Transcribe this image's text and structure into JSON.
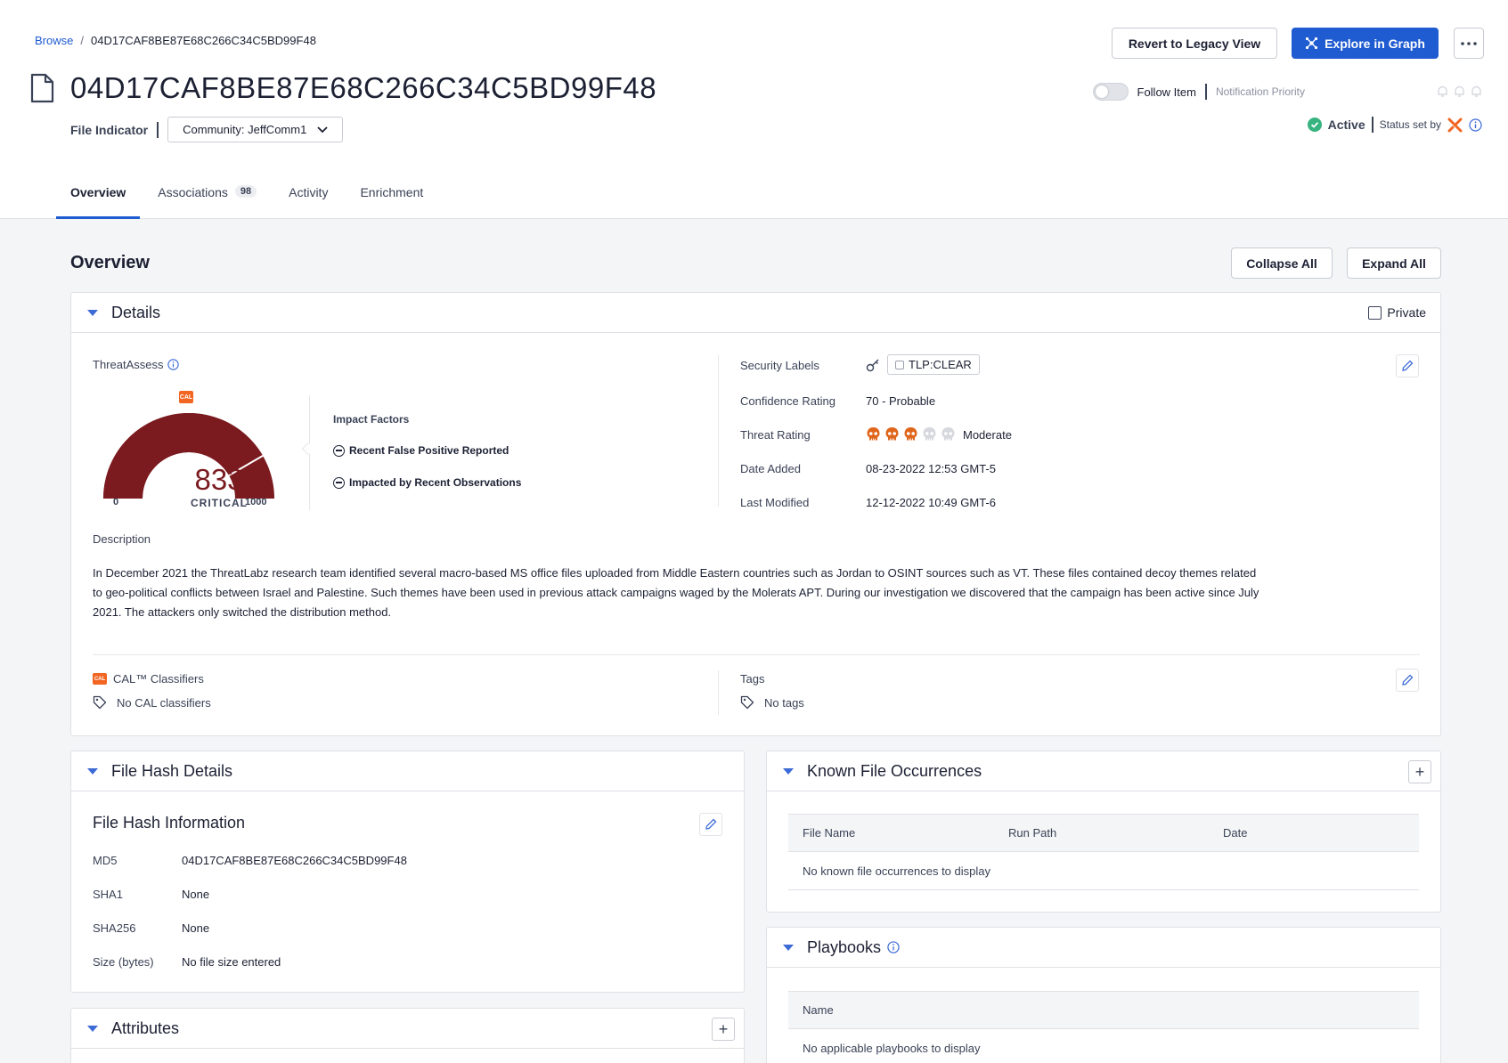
{
  "breadcrumb": {
    "root": "Browse",
    "current": "04D17CAF8BE87E68C266C34C5BD99F48"
  },
  "header": {
    "title": "04D17CAF8BE87E68C266C34C5BD99F48",
    "type": "File Indicator",
    "community": "Community: JeffComm1",
    "revert_label": "Revert to Legacy View",
    "explore_label": "Explore in Graph",
    "follow_label": "Follow Item",
    "notification_label": "Notification Priority",
    "status": "Active",
    "status_set_by": "Status set by"
  },
  "tabs": [
    {
      "label": "Overview"
    },
    {
      "label": "Associations",
      "count": "98"
    },
    {
      "label": "Activity"
    },
    {
      "label": "Enrichment"
    }
  ],
  "overview": {
    "title": "Overview",
    "collapse_label": "Collapse All",
    "expand_label": "Expand All"
  },
  "details": {
    "title": "Details",
    "private_label": "Private",
    "threat_assess_label": "ThreatAssess",
    "cal_badge": "CAL",
    "gauge": {
      "value": 833,
      "min": 0,
      "max": 1000,
      "label": "CRITICAL",
      "min_label": "0",
      "max_label": "1000",
      "value_label": "833"
    },
    "impact_title": "Impact Factors",
    "impact_items": [
      "Recent False Positive Reported",
      "Impacted by Recent Observations"
    ],
    "security_labels_label": "Security Labels",
    "tlp": "TLP:CLEAR",
    "confidence_label": "Confidence Rating",
    "confidence_value": "70 - Probable",
    "threat_rating_label": "Threat Rating",
    "threat_rating_value": "Moderate",
    "threat_rating_level": 3,
    "threat_rating_max": 5,
    "date_added_label": "Date Added",
    "date_added_value": "08-23-2022 12:53 GMT-5",
    "last_modified_label": "Last Modified",
    "last_modified_value": "12-12-2022 10:49 GMT-6",
    "description_label": "Description",
    "description_lines": [
      "In December 2021 the ThreatLabz research team identified several macro-based MS office files uploaded from Middle Eastern countries such as Jordan to OSINT sources such as VT. These files contained decoy themes related",
      "to geo-political conflicts between Israel and Palestine. Such themes have been used in previous attack campaigns waged by the Molerats APT. During our investigation we discovered that the campaign has been active since July",
      "2021. The attackers only switched the distribution method."
    ],
    "cal_classifiers_label": "CAL™ Classifiers",
    "cal_classifiers_value": "No CAL classifiers",
    "tags_label": "Tags",
    "tags_value": "No tags"
  },
  "file_hash": {
    "title": "File Hash Details",
    "subtitle": "File Hash Information",
    "rows": [
      {
        "label": "MD5",
        "value": "04D17CAF8BE87E68C266C34C5BD99F48"
      },
      {
        "label": "SHA1",
        "value": "None"
      },
      {
        "label": "SHA256",
        "value": "None"
      },
      {
        "label": "Size (bytes)",
        "value": "No file size entered"
      }
    ]
  },
  "attributes": {
    "title": "Attributes"
  },
  "known_occurrences": {
    "title": "Known File Occurrences",
    "columns": [
      "File Name",
      "Run Path",
      "Date"
    ],
    "empty": "No known file occurrences to display"
  },
  "playbooks": {
    "title": "Playbooks",
    "columns": [
      "Name"
    ],
    "empty": "No applicable playbooks to display"
  },
  "colors": {
    "primary": "#1f5bd1",
    "gauge": "#7b1a1f",
    "skull_active": "#e0661b",
    "skull_inactive": "#d6d8de",
    "status_green": "#36b37e",
    "cal_orange": "#f26522"
  }
}
